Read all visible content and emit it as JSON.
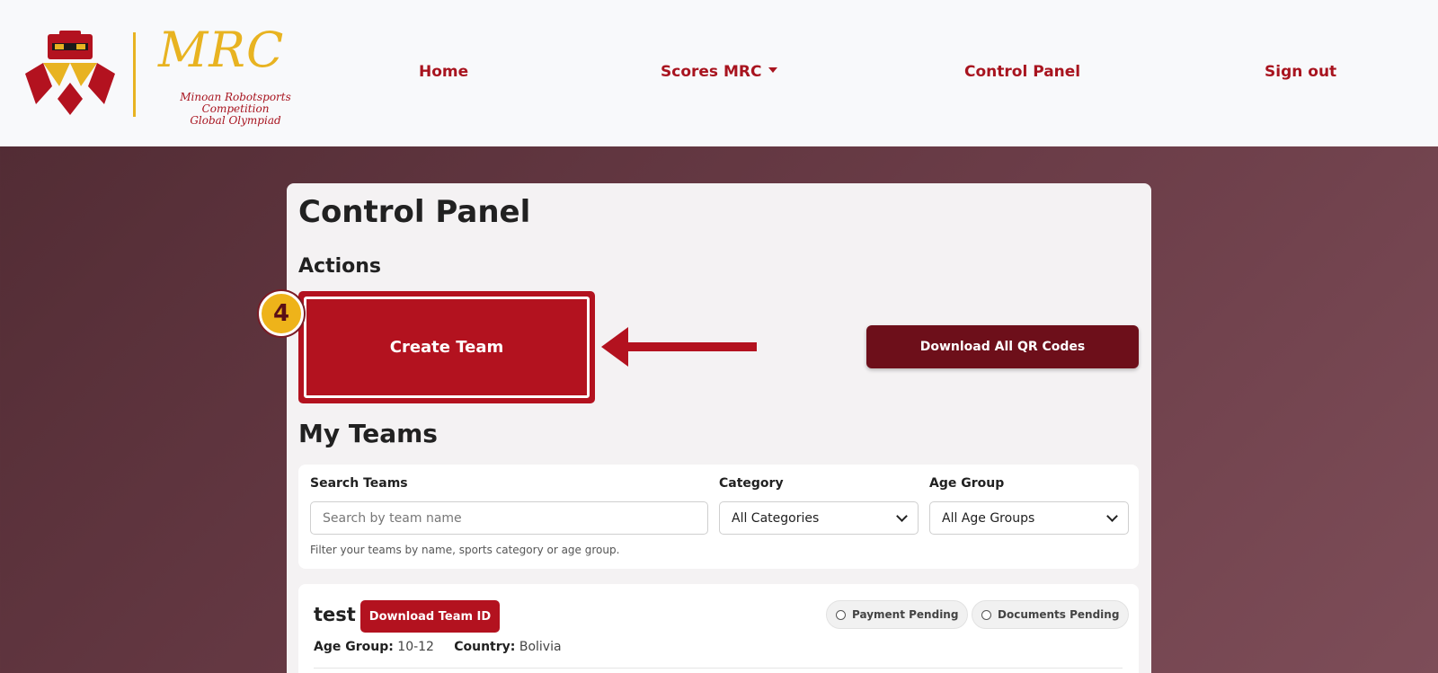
{
  "brand": {
    "name": "MRC",
    "subtitle_line1": "Minoan Robotsports Competition",
    "subtitle_line2": "Global Olympiad"
  },
  "nav": {
    "home": "Home",
    "scores": "Scores MRC",
    "control_panel": "Control Panel",
    "sign_out": "Sign out"
  },
  "page": {
    "title": "Control Panel",
    "actions_heading": "Actions",
    "create_team": "Create Team",
    "download_qr": "Download All QR Codes",
    "step_number": "4",
    "my_teams_heading": "My Teams"
  },
  "filters": {
    "search_label": "Search Teams",
    "search_placeholder": "Search by team name",
    "category_label": "Category",
    "category_value": "All Categories",
    "age_label": "Age Group",
    "age_value": "All Age Groups",
    "help_text": "Filter your teams by name, sports category or age group."
  },
  "team": {
    "name": "test",
    "download_id": "Download Team ID",
    "payment_status": "Payment Pending",
    "documents_status": "Documents Pending",
    "age_group_label": "Age Group:",
    "age_group_value": "10-12",
    "country_label": "Country:",
    "country_value": "Bolivia"
  },
  "colors": {
    "primary_red": "#b3121f",
    "dark_red": "#6d0f1a",
    "gold": "#e8b321",
    "header_bg": "#f8f9fb"
  }
}
